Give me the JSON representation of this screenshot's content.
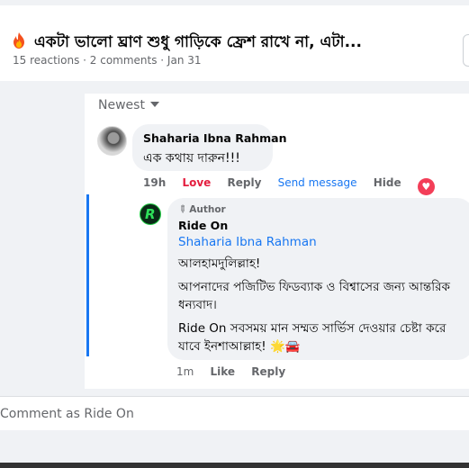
{
  "post": {
    "title": "একটা ভালো ঘ্রাণ শুধু গাড়িকে ফ্রেশ রাখে না, এটা...",
    "meta": "15 reactions · 2 comments · Jan 31",
    "title_icon": "fire-icon"
  },
  "comments": {
    "sort_label": "Newest",
    "first": {
      "author": "Shaharia Ibna Rahman",
      "text": "এক কথায় দারুন!!!",
      "time": "19h",
      "reaction_label": "Love",
      "reply_label": "Reply",
      "send_message_label": "Send message",
      "hide_label": "Hide"
    },
    "reply": {
      "badge": "Author",
      "author": "Ride On",
      "mention": "Shaharia Ibna Rahman",
      "line1": "আলহামদুলিল্লাহ!",
      "line2": "আপনাদের পজিটিভ ফিডব্যাক ও বিশ্বাসের জন্য আন্তরিক ধন্যবাদ।",
      "line3": "Ride On সবসময় মান সম্মত সার্ভিস দেওয়ার চেষ্টা করে যাবে ইনশাআল্লাহ! 🌟🚘",
      "time": "1m",
      "like_label": "Like",
      "reply_label": "Reply"
    }
  },
  "composer": {
    "placeholder": "Comment as Ride On"
  },
  "colors": {
    "link": "#1877f2",
    "love": "#e41e3f",
    "muted": "#65676b"
  }
}
